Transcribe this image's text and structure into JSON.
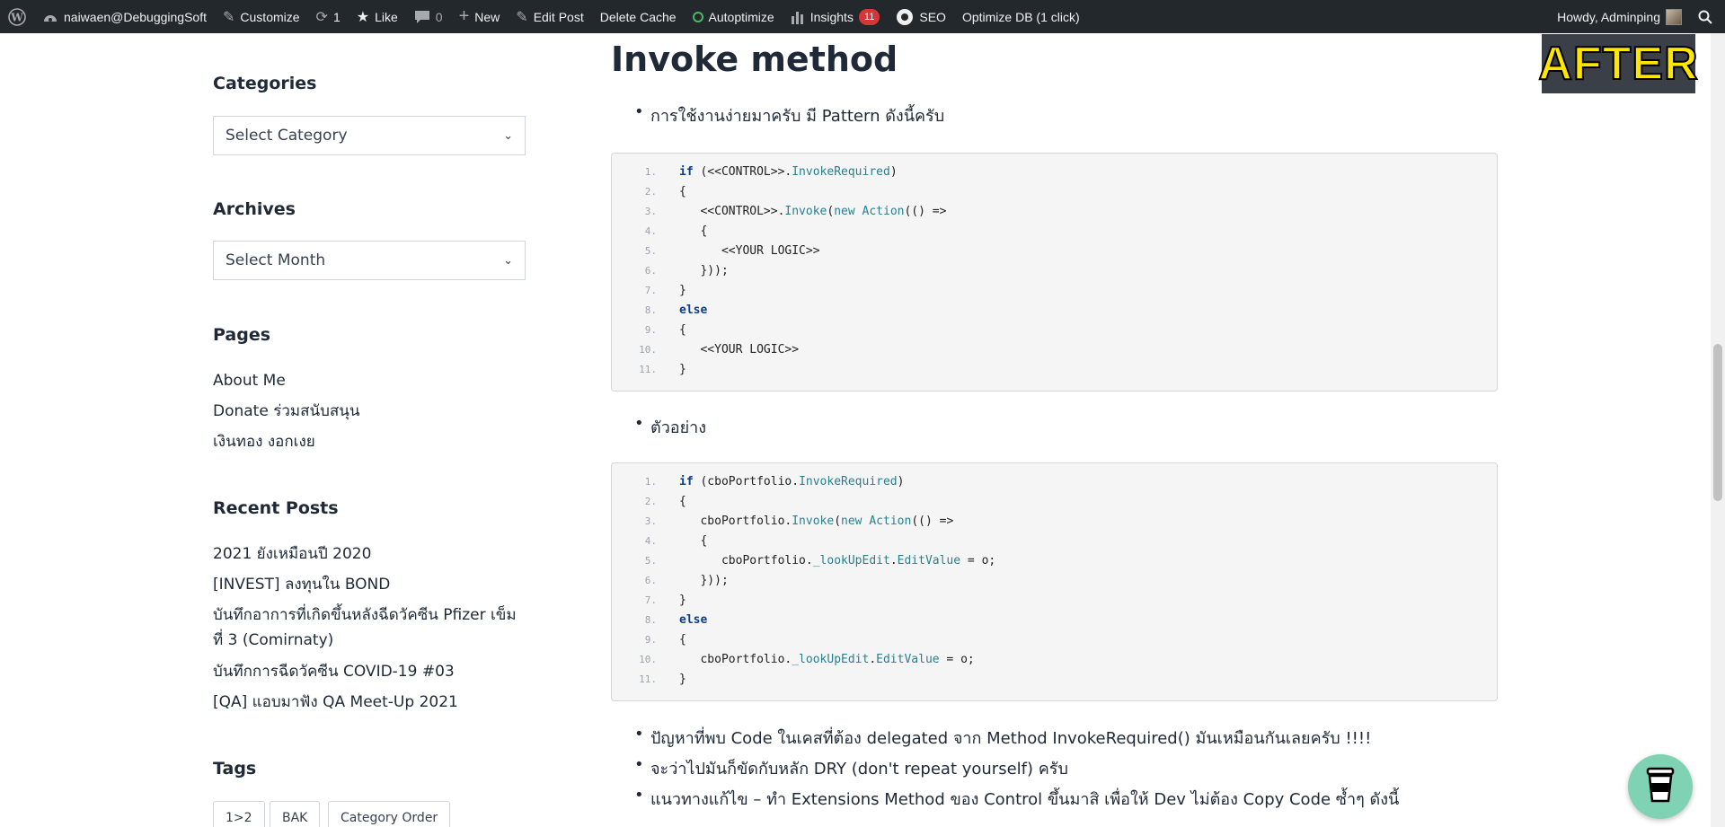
{
  "adminbar": {
    "site": "naiwaen@DebuggingSoft",
    "customize": "Customize",
    "updates_count": "1",
    "like": "Like",
    "comments_count": "0",
    "new": "New",
    "edit_post": "Edit Post",
    "delete_cache": "Delete Cache",
    "autoptimize": "Autoptimize",
    "insights": "Insights",
    "insights_count": "11",
    "seo": "SEO",
    "optimize_db": "Optimize DB (1 click)",
    "howdy": "Howdy, Adminping"
  },
  "sidebar": {
    "categories_title": "Categories",
    "categories_select": "Select Category",
    "archives_title": "Archives",
    "archives_select": "Select Month",
    "pages_title": "Pages",
    "pages": [
      "About Me",
      "Donate ร่วมสนับสนุน",
      "เงินทอง งอกเงย"
    ],
    "recent_title": "Recent Posts",
    "recent": [
      "2021 ยังเหมือนปี 2020",
      "[INVEST] ลงทุนใน BOND",
      "บันทึกอาการที่เกิดขึ้นหลังฉีดวัคซีน Pfizer เข็มที่ 3 (Comirnaty)",
      "บันทึกการฉีดวัคซีน COVID-19 #03",
      "[QA] แอบมาฟัง QA Meet-Up 2021"
    ],
    "tags_title": "Tags",
    "tags": [
      "1>2",
      "BAK",
      "Category Order"
    ]
  },
  "content": {
    "title": "Invoke method",
    "bullet1": "การใช้งานง่ายมาครับ มี Pattern ดังนี้ครับ",
    "bullet2": "ตัวอย่าง",
    "bullet3": "ปัญหาที่พบ Code ในเคสที่ต้อง delegated จาก Method InvokeRequired() มันเหมือนกันเลยครับ !!!!",
    "bullet4": "จะว่าไปมันก็ขัดกับหลัก DRY (don't repeat yourself) ครับ",
    "bullet5": "แนวทางแก้ไข – ทำ Extensions Method ของ Control ขึ้นมาสิ เพื่อให้ Dev ไม่ต้อง Copy Code ซ้ำๆ ดังนี้",
    "code1": [
      {
        "n": "1.",
        "t": "if (<<CONTROL>>.InvokeRequired)"
      },
      {
        "n": "2.",
        "t": "{"
      },
      {
        "n": "3.",
        "t": "   <<CONTROL>>.Invoke(new Action(() =>"
      },
      {
        "n": "4.",
        "t": "   {"
      },
      {
        "n": "5.",
        "t": "      <<YOUR LOGIC>>"
      },
      {
        "n": "6.",
        "t": "   }));"
      },
      {
        "n": "7.",
        "t": "}"
      },
      {
        "n": "8.",
        "t": "else"
      },
      {
        "n": "9.",
        "t": "{"
      },
      {
        "n": "10.",
        "t": "   <<YOUR LOGIC>>"
      },
      {
        "n": "11.",
        "t": "}"
      }
    ],
    "code2": [
      {
        "n": "1.",
        "t": "if (cboPortfolio.InvokeRequired)"
      },
      {
        "n": "2.",
        "t": "{"
      },
      {
        "n": "3.",
        "t": "   cboPortfolio.Invoke(new Action(() =>"
      },
      {
        "n": "4.",
        "t": "   {"
      },
      {
        "n": "5.",
        "t": "      cboPortfolio._lookUpEdit.EditValue = o;"
      },
      {
        "n": "6.",
        "t": "   }));"
      },
      {
        "n": "7.",
        "t": "}"
      },
      {
        "n": "8.",
        "t": "else"
      },
      {
        "n": "9.",
        "t": "{"
      },
      {
        "n": "10.",
        "t": "   cboPortfolio._lookUpEdit.EditValue = o;"
      },
      {
        "n": "11.",
        "t": "}"
      }
    ]
  },
  "after_label": "AFTER"
}
